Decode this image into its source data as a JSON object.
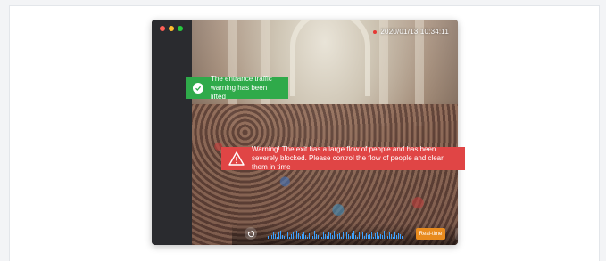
{
  "video": {
    "timestamp": "2020/01/13 10:34:11"
  },
  "alerts": {
    "success_text": "The entrance traffic warning has been lifted",
    "warning_text": "Warning! The exit has a large flow of people and has been severely blocked. Please control the flow of people and clear them in time"
  },
  "controls": {
    "realtime_label": "Real-time"
  },
  "colors": {
    "success": "#2faa4a",
    "warning": "#e04545",
    "accent": "#e88b1e",
    "waveform": "#3da2ff"
  },
  "icons": [
    "check-icon",
    "warning-icon",
    "replay-icon",
    "microphone-icon",
    "camera-icon"
  ]
}
